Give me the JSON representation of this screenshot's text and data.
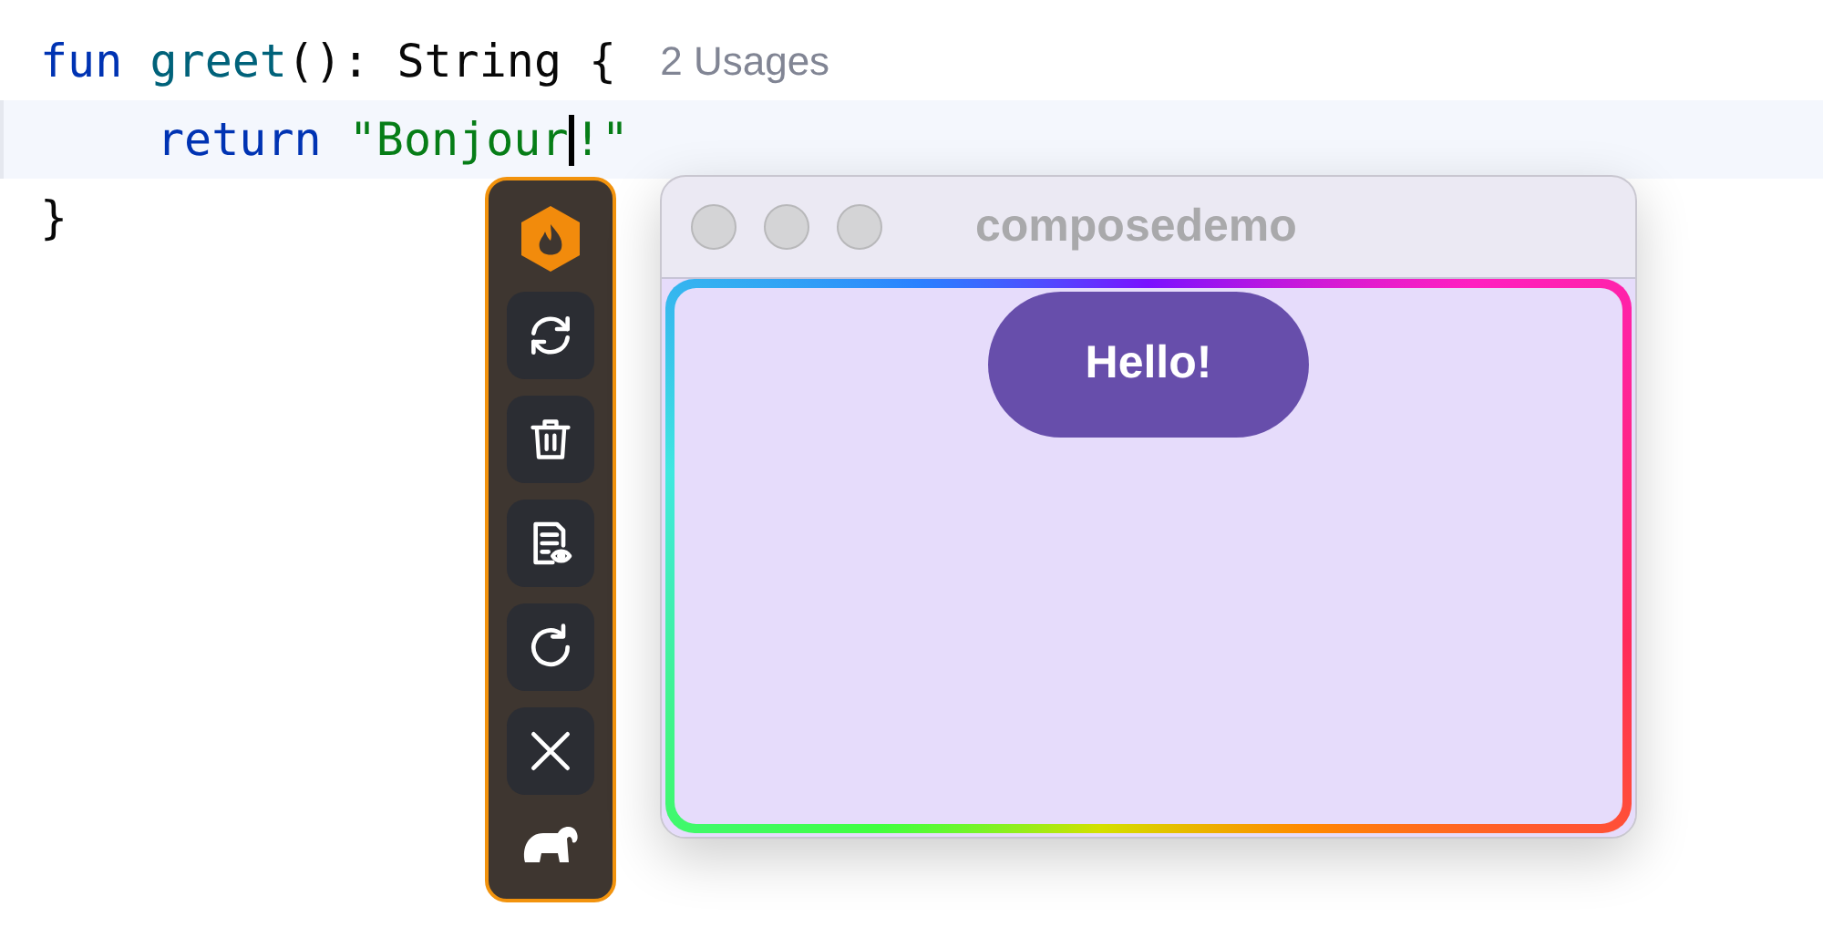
{
  "editor": {
    "lines": [
      {
        "highlighted": false,
        "indented": false,
        "tokens": [
          {
            "kind": "keyword",
            "text": "fun "
          },
          {
            "kind": "function",
            "text": "greet"
          },
          {
            "kind": "plain",
            "text": "(): String {"
          },
          {
            "kind": "hint",
            "text": "2 Usages"
          }
        ]
      },
      {
        "highlighted": true,
        "indented": true,
        "tokens": [
          {
            "kind": "keyword",
            "text": "return "
          },
          {
            "kind": "string",
            "text": "\"Bonjour"
          },
          {
            "kind": "caret"
          },
          {
            "kind": "string",
            "text": "!\""
          }
        ]
      },
      {
        "highlighted": false,
        "indented": false,
        "tokens": [
          {
            "kind": "plain",
            "text": "}"
          }
        ]
      }
    ]
  },
  "app_window": {
    "title": "composedemo",
    "button": "Hello!"
  }
}
